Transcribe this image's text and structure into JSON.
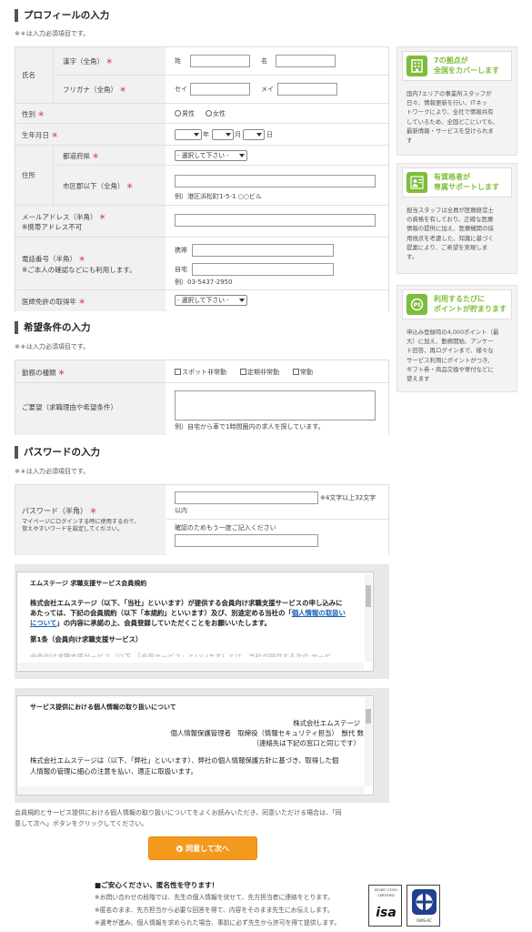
{
  "profile": {
    "title": "プロフィールの入力",
    "required_note": "※＊は入力必須項目です。",
    "name": {
      "label": "氏名",
      "kanji_label": "漢字（全角）",
      "kana_label": "フリガナ（全角）",
      "sei": "姓",
      "mei": "名",
      "sei_kana": "セイ",
      "mei_kana": "メイ"
    },
    "gender": {
      "label": "性別",
      "male": "男性",
      "female": "女性"
    },
    "birth": {
      "label": "生年月日",
      "year": "年",
      "month": "月",
      "day": "日"
    },
    "address": {
      "label": "住所",
      "pref_label": "都道府県",
      "pref_select": "- 選択して下さい -",
      "city_label": "市区郡以下（全角）",
      "city_example": "例）港区浜松町1-5-1 ○○ビル"
    },
    "email": {
      "label": "メールアドレス（半角）",
      "sub": "※携帯アドレス不可"
    },
    "phone": {
      "label": "電話番号（半角）",
      "sub": "※ご本人の確認などにも利用します。",
      "mobile": "携帯",
      "home": "自宅",
      "example": "例）03-5437-2950"
    },
    "license": {
      "label": "医師免許の取得年",
      "select": "- 選択して下さい -"
    },
    "req_mark": "＊"
  },
  "conditions": {
    "title": "希望条件の入力",
    "required_note": "※＊は入力必須項目です。",
    "work_type": {
      "label": "勤務の種類",
      "options": [
        "スポット非常勤",
        "定期非常勤",
        "常勤"
      ]
    },
    "request": {
      "label": "ご要望（求職理由や希望条件）",
      "example": "例）自宅から車で1時間圏内の求人を探しています。"
    }
  },
  "password": {
    "title": "パスワードの入力",
    "required_note": "※＊は入力必須項目です。",
    "label": "パスワード（半角）",
    "sub1": "マイページにログインする時に使用するので、",
    "sub2": "覚えやすいワードを設定してください。",
    "hint1": "※4文字以上32文字",
    "hint2": "以内",
    "confirm": "確認のためもう一度ご記入ください"
  },
  "terms": {
    "title": "エムステージ 求職支援サービス会員規約",
    "p1": "株式会社エムステージ（以下、「当社」といいます）が提供する会員向け求職支援サービスの申し込みに",
    "p2": "あたっては、下記の会員規約（以下「本規約」といいます）及び、別途定める当社の「",
    "link1": "個人情報の取扱い",
    "link2": "について",
    "p3": "」の内容に承諾の上、会員登録していただくことをお願いいたします。",
    "art1": "第1条（会員向け求職支援サービス）",
    "cut": "会員向け求職支援サービス（以下、「会員サービス」といいます）とは、当社が提供する次の サービ"
  },
  "privacy": {
    "title": "サービス提供における個人情報の取り扱いについて",
    "company": "株式会社エムステージ",
    "manager": "個人情報保護管理者　取締役（情報セキュリティ担当）　獣代 数",
    "contact": "（連絡先は下記の窓口と同じです）",
    "p1": "株式会社エムステージは（以下、「弊社」といいます）、弊社の個人情報保護方針に基づき、取得した個",
    "p2": "人情報の管理に細心の注意を払い、適正に取扱います。"
  },
  "agree_note1": "会員規約とサービス提供における個人情報の取り扱いについてをよくお読みいただき、同意いただける場合は、「同",
  "agree_note2": "意して次へ」ボタンをクリックしてください。",
  "agree_button": "同意して次へ",
  "footer": {
    "title": "■ご安心ください、匿名性を守ります！",
    "l1": "※お問い合わせの段階では、先生の個人情報を伏せて、先方担当者に連絡をとります。",
    "l2": "※匿名のまま、先方担当から必要な回答を得て、内容をそのまま先生にお伝えします。",
    "l3": "※選考が進み、個人情報を求められた場合、事前に必ず先生から許可を得て提供します。",
    "iso_top": "ISO/IEC 27001",
    "iso_mid": "CERTIFIED",
    "isa": "isa",
    "isms": "ISMS-AC"
  },
  "sidebar": [
    {
      "title1": "7の拠点が",
      "title2": "全国をカバーします",
      "body": [
        "国内7エリアの事業所スタッフが",
        "日々、情報更新を行い、ITネッ",
        "トワークにより、全社で情報共有",
        "しているため、全国どこにいても、",
        "最新情報・サービスを受けられま",
        "す"
      ]
    },
    {
      "title1": "有資格者が",
      "title2": "専属サポートします",
      "body": [
        "担当スタッフは全員が医療経営士",
        "の資格を有しており、正確な医療",
        "情報の提供に加え、医療機関の採",
        "用視点を考慮した、知識に基づく",
        "提案により、ご希望を実現しま",
        "す。"
      ]
    },
    {
      "title1": "利用するたびに",
      "title2": "ポイントが貯まります",
      "body": [
        "申込み登録時の4,000ポイント（最",
        "大）に加え、勤務開始、アンケー",
        "ト回答、再ログインまで、様々な",
        "サービス利用にポイントがつき、",
        "ギフト券・商品交換や寄付などに",
        "使えます"
      ]
    }
  ]
}
